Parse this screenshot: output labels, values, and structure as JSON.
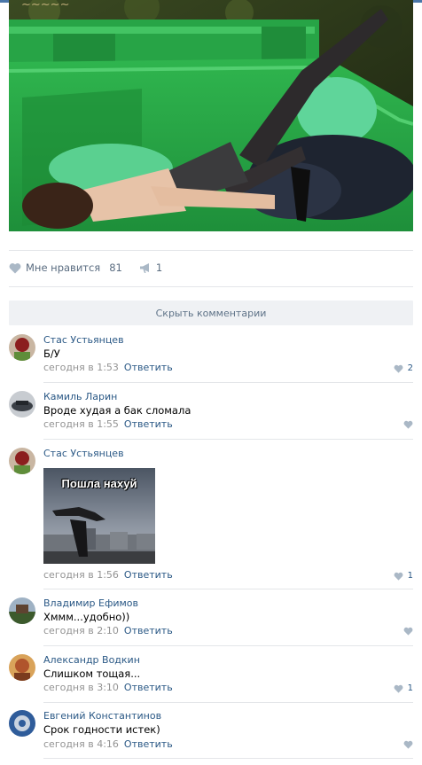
{
  "post": {
    "likes_label": "Мне нравится",
    "likes_count": "81",
    "shares_count": "1"
  },
  "comments_toggle": "Скрыть комментарии",
  "reply_label": "Ответить",
  "comments": [
    {
      "author": "Стас Устьянцев",
      "text": "Б/У",
      "time": "сегодня в 1:53",
      "likes": "2"
    },
    {
      "author": "Камиль Ларин",
      "text": "Вроде худая а бак сломала",
      "time": "сегодня в 1:55",
      "likes": ""
    },
    {
      "author": "Стас Устьянцев",
      "meme_caption": "Пошла нахуй",
      "time": "сегодня в 1:56",
      "likes": "1"
    },
    {
      "author": "Владимир Ефимов",
      "text": "Хммм...удобно))",
      "time": "сегодня в 2:10",
      "likes": ""
    },
    {
      "author": "Александр Водкин",
      "text": "Слишком тощая...",
      "time": "сегодня в 3:10",
      "likes": "1"
    },
    {
      "author": "Евгений Константинов",
      "text": "Срок годности истек)",
      "time": "сегодня в 4:16",
      "likes": ""
    }
  ],
  "colors": {
    "link": "#2a5885",
    "meta": "#939393",
    "toggle_bg": "#eff1f4",
    "heart": "#aab8c6"
  }
}
